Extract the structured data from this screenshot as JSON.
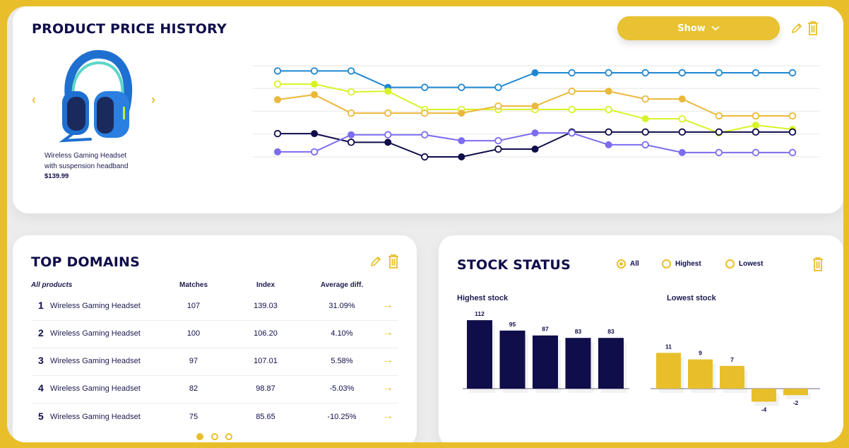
{
  "price_history": {
    "title": "PRODUCT PRICE HISTORY",
    "show_button": "Show",
    "show_icon": "chevron-down-icon",
    "edit_icon": "pencil-icon",
    "delete_icon": "trash-icon",
    "product": {
      "name_line1": "Wireless Gaming Headset",
      "name_line2": "with suspension headband",
      "price": "$139.99",
      "prev_icon": "chevron-left-icon",
      "next_icon": "chevron-right-icon"
    }
  },
  "chart_data": [
    {
      "type": "line",
      "title": "Product price history",
      "x": [
        1,
        2,
        3,
        4,
        5,
        6,
        7,
        8,
        9,
        10,
        11,
        12,
        13,
        14,
        15
      ],
      "ylim": [
        1,
        5
      ],
      "grid": true,
      "gridlines": 5,
      "series": [
        {
          "name": "series-blue",
          "color": "#1f87d1",
          "values": [
            4.77,
            4.77,
            4.77,
            4.05,
            4.05,
            4.05,
            4.05,
            4.69,
            4.69,
            4.69,
            4.69,
            4.69,
            4.69,
            4.69,
            4.69
          ],
          "filled": [
            false,
            false,
            false,
            true,
            false,
            false,
            false,
            true,
            false,
            false,
            false,
            false,
            false,
            false,
            false
          ]
        },
        {
          "name": "series-lime",
          "color": "#d8f324",
          "values": [
            4.19,
            4.19,
            3.85,
            3.88,
            3.08,
            3.08,
            3.08,
            3.08,
            3.08,
            3.08,
            2.67,
            2.67,
            2.05,
            2.39,
            2.21
          ],
          "filled": [
            false,
            true,
            false,
            true,
            false,
            false,
            false,
            false,
            false,
            false,
            true,
            false,
            true,
            true,
            true
          ]
        },
        {
          "name": "series-orange",
          "color": "#ebb93a",
          "values": [
            3.51,
            3.73,
            2.92,
            2.92,
            2.92,
            2.92,
            3.23,
            3.23,
            3.88,
            3.88,
            3.54,
            3.54,
            2.8,
            2.8,
            2.8
          ],
          "filled": [
            true,
            true,
            false,
            false,
            false,
            true,
            false,
            true,
            false,
            true,
            false,
            true,
            false,
            false,
            false
          ]
        },
        {
          "name": "series-navy",
          "color": "#0f0d4a",
          "values": [
            2.02,
            2.02,
            1.64,
            1.64,
            1.0,
            1.0,
            1.34,
            1.34,
            2.09,
            2.09,
            2.09,
            2.09,
            2.09,
            2.09,
            2.09
          ],
          "filled": [
            false,
            true,
            false,
            true,
            false,
            true,
            false,
            true,
            false,
            false,
            false,
            false,
            false,
            false,
            false
          ]
        },
        {
          "name": "series-purple",
          "color": "#7b6cf0",
          "values": [
            1.22,
            1.22,
            1.97,
            1.97,
            1.97,
            1.71,
            1.71,
            2.05,
            2.05,
            1.53,
            1.53,
            1.19,
            1.19,
            1.19,
            1.19
          ],
          "filled": [
            true,
            false,
            true,
            false,
            false,
            true,
            false,
            true,
            false,
            true,
            false,
            true,
            false,
            false,
            false
          ]
        }
      ]
    },
    {
      "type": "bar",
      "title": "Highest stock",
      "categories": [
        "1",
        "2",
        "3",
        "4",
        "5"
      ],
      "values": [
        112,
        95,
        87,
        83,
        83
      ],
      "color": "#0f0d4a"
    },
    {
      "type": "bar",
      "title": "Lowest stock",
      "categories": [
        "1",
        "2",
        "3",
        "4",
        "5"
      ],
      "values": [
        11,
        9,
        7,
        -4,
        -2
      ],
      "color": "#e8bf2a"
    }
  ],
  "top_domains": {
    "title": "TOP DOMAINS",
    "edit_icon": "pencil-icon",
    "delete_icon": "trash-icon",
    "columns": [
      "All products",
      "Matches",
      "Index",
      "Average diff."
    ],
    "rows": [
      {
        "rank": "1",
        "name": "Wireless Gaming Headset",
        "matches": "107",
        "index": "139.03",
        "avg": "31.09%"
      },
      {
        "rank": "2",
        "name": "Wireless Gaming Headset",
        "matches": "100",
        "index": "106.20",
        "avg": "4.10%"
      },
      {
        "rank": "3",
        "name": "Wireless Gaming Headset",
        "matches": "97",
        "index": "107.01",
        "avg": "5.58%"
      },
      {
        "rank": "4",
        "name": "Wireless Gaming Headset",
        "matches": "82",
        "index": "98.87",
        "avg": "-5.03%"
      },
      {
        "rank": "5",
        "name": "Wireless Gaming Headset",
        "matches": "75",
        "index": "85.65",
        "avg": "-10.25%"
      }
    ],
    "arrow": "→",
    "pagination": {
      "pages": 3,
      "active": 1
    }
  },
  "stock_status": {
    "title": "STOCK STATUS",
    "filters": [
      {
        "label": "All",
        "checked": true
      },
      {
        "label": "Highest",
        "checked": false
      },
      {
        "label": "Lowest",
        "checked": false
      }
    ],
    "highest_label": "Highest stock",
    "lowest_label": "Lowest stock",
    "delete_icon": "trash-icon"
  },
  "colors": {
    "accent": "#e8bf2a",
    "navy": "#0f0d4a"
  }
}
